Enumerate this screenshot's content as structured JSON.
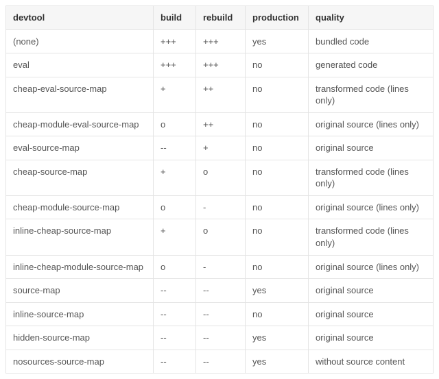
{
  "table": {
    "headers": [
      "devtool",
      "build",
      "rebuild",
      "production",
      "quality"
    ],
    "rows": [
      {
        "devtool": "(none)",
        "build": "+++",
        "rebuild": "+++",
        "production": "yes",
        "quality": "bundled code"
      },
      {
        "devtool": "eval",
        "build": "+++",
        "rebuild": "+++",
        "production": "no",
        "quality": "generated code"
      },
      {
        "devtool": "cheap-eval-source-map",
        "build": "+",
        "rebuild": "++",
        "production": "no",
        "quality": "transformed code (lines only)"
      },
      {
        "devtool": "cheap-module-eval-source-map",
        "build": "o",
        "rebuild": "++",
        "production": "no",
        "quality": "original source (lines only)"
      },
      {
        "devtool": "eval-source-map",
        "build": "--",
        "rebuild": "+",
        "production": "no",
        "quality": "original source"
      },
      {
        "devtool": "cheap-source-map",
        "build": "+",
        "rebuild": "o",
        "production": "no",
        "quality": "transformed code (lines only)"
      },
      {
        "devtool": "cheap-module-source-map",
        "build": "o",
        "rebuild": "-",
        "production": "no",
        "quality": "original source (lines only)"
      },
      {
        "devtool": "inline-cheap-source-map",
        "build": "+",
        "rebuild": "o",
        "production": "no",
        "quality": "transformed code (lines only)"
      },
      {
        "devtool": "inline-cheap-module-source-map",
        "build": "o",
        "rebuild": "-",
        "production": "no",
        "quality": "original source (lines only)"
      },
      {
        "devtool": "source-map",
        "build": "--",
        "rebuild": "--",
        "production": "yes",
        "quality": "original source"
      },
      {
        "devtool": "inline-source-map",
        "build": "--",
        "rebuild": "--",
        "production": "no",
        "quality": "original source"
      },
      {
        "devtool": "hidden-source-map",
        "build": "--",
        "rebuild": "--",
        "production": "yes",
        "quality": "original source"
      },
      {
        "devtool": "nosources-source-map",
        "build": "--",
        "rebuild": "--",
        "production": "yes",
        "quality": "without source content"
      }
    ]
  }
}
